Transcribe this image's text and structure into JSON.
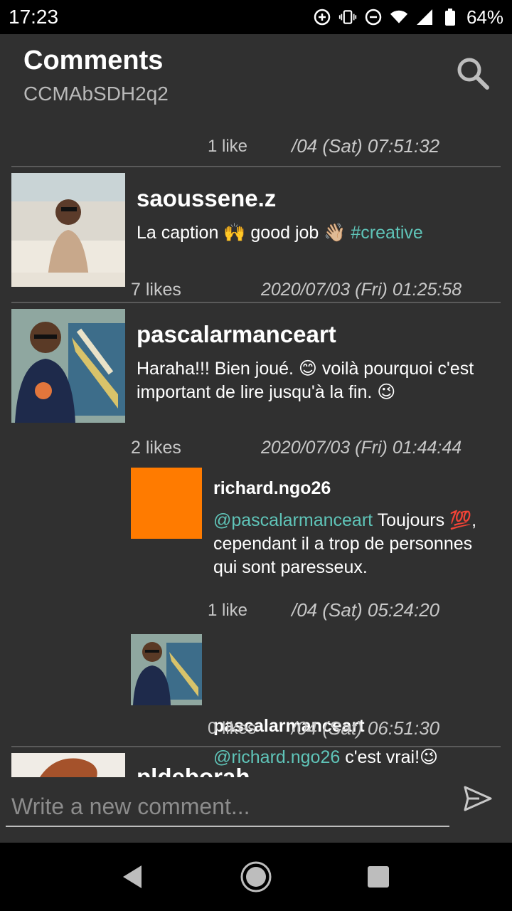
{
  "status": {
    "time": "17:23",
    "battery": "64%"
  },
  "header": {
    "title": "Comments",
    "subtitle": "CCMAbSDH2q2"
  },
  "comments": [
    {
      "likes": "1 like",
      "date": "/04 (Sat) 07:51:32"
    },
    {
      "username": "saoussene.z",
      "text_prefix": "La caption 🙌 good job 👋🏼 ",
      "hashtag": "#creative",
      "likes": "7 likes",
      "date": "2020/07/03 (Fri) 01:25:58"
    },
    {
      "username": "pascalarmanceart",
      "text": "Haraha!!! Bien joué. 😊 voilà pourquoi c'est important de lire jusqu'à la fin. 😉",
      "likes": "2 likes",
      "date": "2020/07/03 (Fri) 01:44:44"
    }
  ],
  "replies": [
    {
      "username": "richard.ngo26",
      "mention": "@pascalarmanceart",
      "text": " Toujours 💯, cependant il a trop de personnes qui sont paresseux.",
      "likes": "1 like",
      "date": "/04 (Sat) 05:24:20",
      "avatar_color": "#ff7b00"
    },
    {
      "username": "pascalarmanceart",
      "mention": "@richard.ngo26",
      "text": " c'est vrai!😉",
      "likes": "0 likes",
      "date": "/04 (Sat) 06:51:30"
    }
  ],
  "next_comment": {
    "username": "pldeborah"
  },
  "composer": {
    "placeholder": "Write a new comment..."
  },
  "colors": {
    "accent": "#5fc4b8",
    "background": "#303030"
  }
}
